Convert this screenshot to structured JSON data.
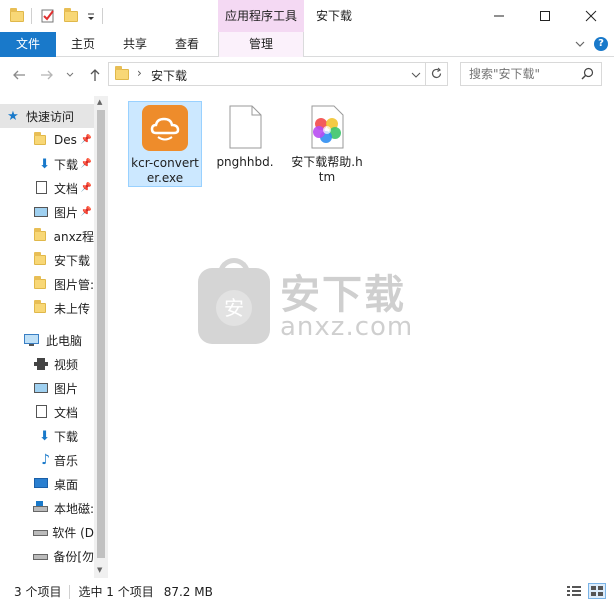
{
  "window": {
    "title": "安下载",
    "context_tab_header": "应用程序工具",
    "controls": {
      "minimize": "—",
      "maximize": "☐",
      "close": "✕"
    }
  },
  "ribbon": {
    "tabs": [
      {
        "label": "文件"
      },
      {
        "label": "主页"
      },
      {
        "label": "共享"
      },
      {
        "label": "查看"
      },
      {
        "label": "管理"
      }
    ]
  },
  "address": {
    "breadcrumb_sep": "›",
    "path": "安下载",
    "search_placeholder": "搜索\"安下载\""
  },
  "navpane": {
    "quick_access_label": "快速访问",
    "items": [
      {
        "label": "快速访问",
        "icon": "star-icon",
        "pinned": false
      },
      {
        "label": "Des",
        "icon": "folder-icon",
        "pinned": true
      },
      {
        "label": "下载",
        "icon": "download-arrow-icon",
        "pinned": true
      },
      {
        "label": "文档",
        "icon": "document-icon",
        "pinned": true
      },
      {
        "label": "图片",
        "icon": "picture-icon",
        "pinned": true
      },
      {
        "label": "anxz程",
        "icon": "folder-icon",
        "pinned": false
      },
      {
        "label": "安下载",
        "icon": "folder-icon",
        "pinned": false
      },
      {
        "label": "图片管:",
        "icon": "folder-icon",
        "pinned": false
      },
      {
        "label": "未上传",
        "icon": "folder-icon",
        "pinned": false
      },
      {
        "label": "此电脑",
        "icon": "computer-icon",
        "pinned": false
      },
      {
        "label": "视频",
        "icon": "video-icon",
        "pinned": false
      },
      {
        "label": "图片",
        "icon": "picture-icon",
        "pinned": false
      },
      {
        "label": "文档",
        "icon": "document-icon",
        "pinned": false
      },
      {
        "label": "下载",
        "icon": "download-arrow-icon",
        "pinned": false
      },
      {
        "label": "音乐",
        "icon": "music-icon",
        "pinned": false
      },
      {
        "label": "桌面",
        "icon": "desktop-icon",
        "pinned": false
      },
      {
        "label": "本地磁:",
        "icon": "drive-icon",
        "pinned": false
      },
      {
        "label": "软件 (D",
        "icon": "drive-icon",
        "pinned": false
      },
      {
        "label": "备份[勿",
        "icon": "drive-icon",
        "pinned": false
      }
    ]
  },
  "files": [
    {
      "name": "kcr-converter.exe",
      "icon": "app-cloud-icon",
      "selected": true
    },
    {
      "name": "pnghhbd.",
      "icon": "blank-file-icon",
      "selected": false
    },
    {
      "name": "安下载帮助.htm",
      "icon": "color-wheel-icon",
      "selected": false
    }
  ],
  "watermark": {
    "cn": "安下载",
    "en": "anxz.com",
    "badge": "安"
  },
  "status": {
    "item_count": "3 个项目",
    "selection": "选中 1 个项目",
    "size": "87.2 MB"
  },
  "colors": {
    "file_tab": "#1979ca",
    "context_tab": "#f4d9f3",
    "selection": "#cce8ff",
    "app_icon_orange": "#ee8c2b"
  }
}
